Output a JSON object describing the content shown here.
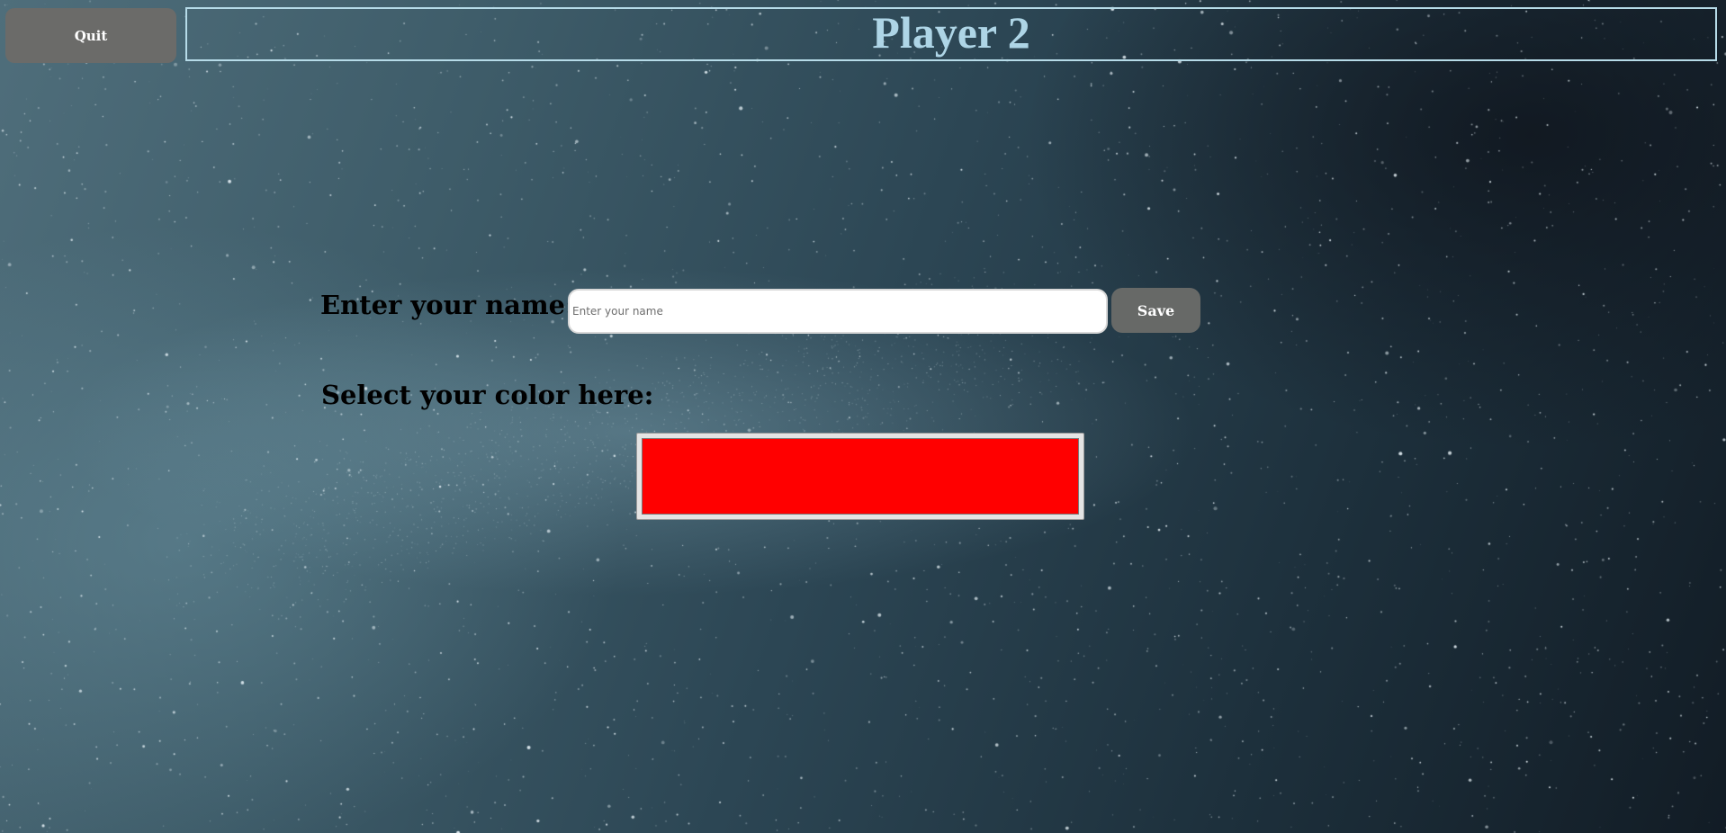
{
  "header": {
    "quit_label": "Quit",
    "title": "Player 2"
  },
  "form": {
    "name_label": "Enter your name:",
    "name_value": "",
    "name_placeholder": "Enter your name",
    "save_label": "Save",
    "color_label": "Select your color here:",
    "selected_color": "#ff0000"
  },
  "colors": {
    "title_text": "#aed5e6",
    "title_border": "#b6dbe8",
    "button_bg": "#6b6b69"
  }
}
